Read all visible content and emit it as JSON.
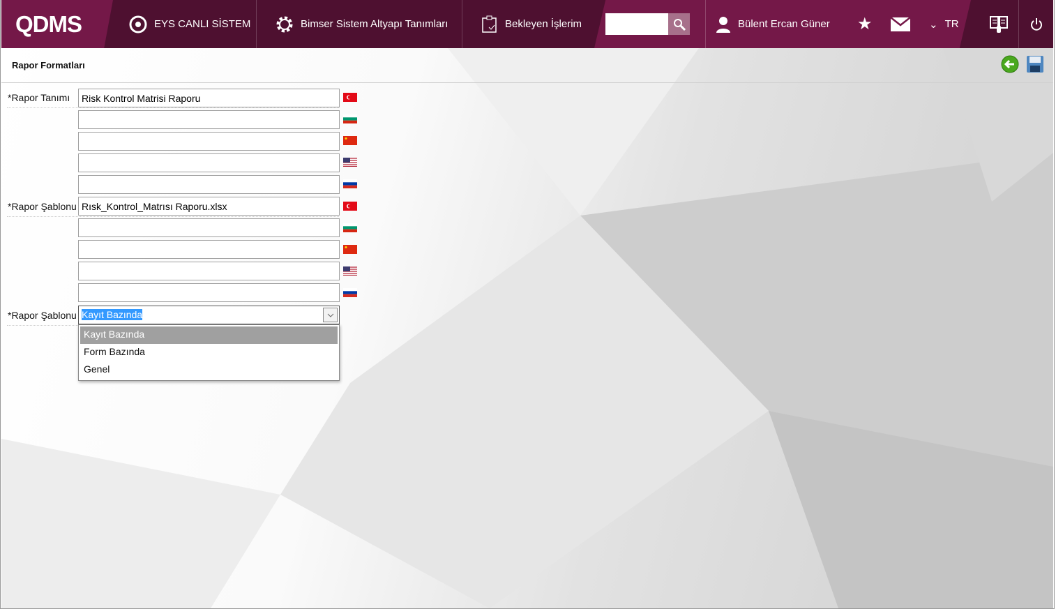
{
  "header": {
    "logo": "QDMS",
    "nav": [
      {
        "label": "EYS CANLI SİSTEM",
        "icon": "q-icon"
      },
      {
        "label": "Bimser Sistem Altyapı Tanımları",
        "icon": "gear-icon"
      },
      {
        "label": "Bekleyen İşlerim",
        "icon": "clipboard-icon"
      }
    ],
    "search": {
      "value": "",
      "placeholder": ""
    },
    "user": "Bülent Ercan Güner",
    "language": "TR"
  },
  "page": {
    "title": "Rapor Formatları"
  },
  "form": {
    "rapor_tanimi": {
      "label": "*Rapor Tanımı",
      "values": [
        "Risk Kontrol Matrisi Raporu",
        "",
        "",
        "",
        ""
      ],
      "flags": [
        "tr",
        "bg",
        "cn",
        "us",
        "ru"
      ]
    },
    "rapor_sablonu_file": {
      "label": "*Rapor Şablonu",
      "values": [
        "Rısk_Kontrol_Matrısı Raporu.xlsx",
        "",
        "",
        "",
        ""
      ],
      "flags": [
        "tr",
        "bg",
        "cn",
        "us",
        "ru"
      ]
    },
    "rapor_sablonu_type": {
      "label": "*Rapor Şablonu",
      "selected": "Kayıt Bazında",
      "options": [
        "Kayıt Bazında",
        "Form Bazında",
        "Genel"
      ]
    }
  }
}
